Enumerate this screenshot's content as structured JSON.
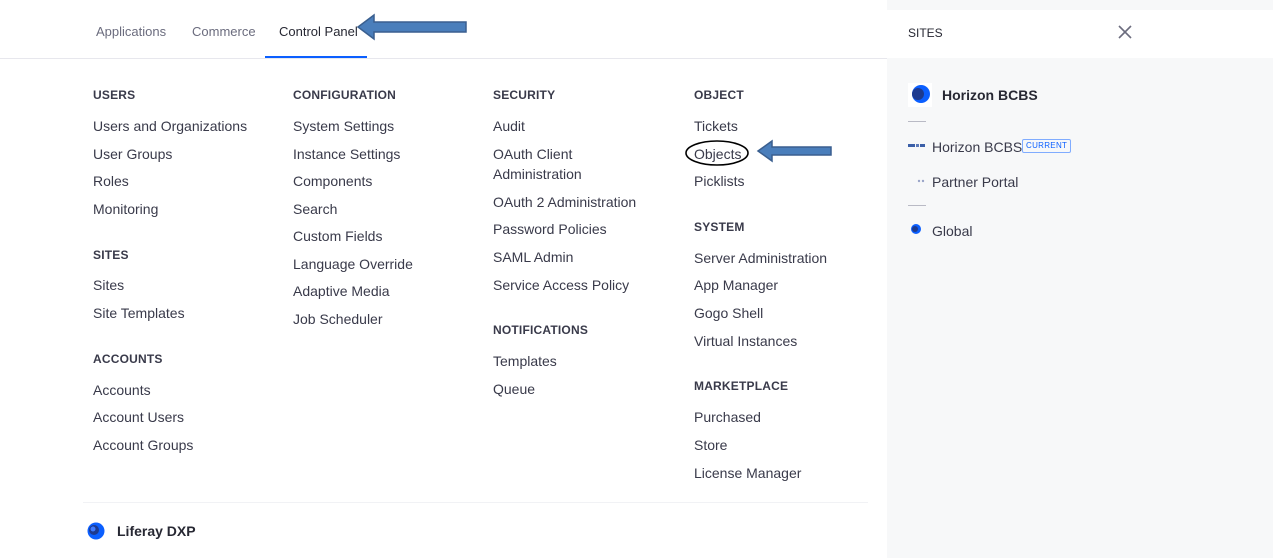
{
  "tabs": {
    "applications": "Applications",
    "commerce": "Commerce",
    "control_panel": "Control Panel"
  },
  "columns": {
    "users": {
      "title": "USERS",
      "items": [
        "Users and Organizations",
        "User Groups",
        "Roles",
        "Monitoring"
      ]
    },
    "sites": {
      "title": "SITES",
      "items": [
        "Sites",
        "Site Templates"
      ]
    },
    "accounts": {
      "title": "ACCOUNTS",
      "items": [
        "Accounts",
        "Account Users",
        "Account Groups"
      ]
    },
    "configuration": {
      "title": "CONFIGURATION",
      "items": [
        "System Settings",
        "Instance Settings",
        "Components",
        "Search",
        "Custom Fields",
        "Language Override",
        "Adaptive Media",
        "Job Scheduler"
      ]
    },
    "security": {
      "title": "SECURITY",
      "items": [
        "Audit",
        "OAuth Client Administration",
        "OAuth 2 Administration",
        "Password Policies",
        "SAML Admin",
        "Service Access Policy"
      ]
    },
    "notifications": {
      "title": "NOTIFICATIONS",
      "items": [
        "Templates",
        "Queue"
      ]
    },
    "object": {
      "title": "OBJECT",
      "items": [
        "Tickets",
        "Objects",
        "Picklists"
      ]
    },
    "system": {
      "title": "SYSTEM",
      "items": [
        "Server Administration",
        "App Manager",
        "Gogo Shell",
        "Virtual Instances"
      ]
    },
    "marketplace": {
      "title": "MARKETPLACE",
      "items": [
        "Purchased",
        "Store",
        "License Manager"
      ]
    }
  },
  "footer": {
    "brand": "Liferay DXP"
  },
  "sidebar": {
    "tab_label": "SITES",
    "current_site": "Horizon BCBS",
    "sites": [
      {
        "name": "Horizon BCBS",
        "badge": "CURRENT"
      },
      {
        "name": "Partner Portal"
      }
    ],
    "global": "Global"
  },
  "colors": {
    "accent": "#0b5fff",
    "arrow_fill": "#4a7ebb",
    "arrow_stroke": "#3a5f8f",
    "logo": "#0b5fff"
  }
}
